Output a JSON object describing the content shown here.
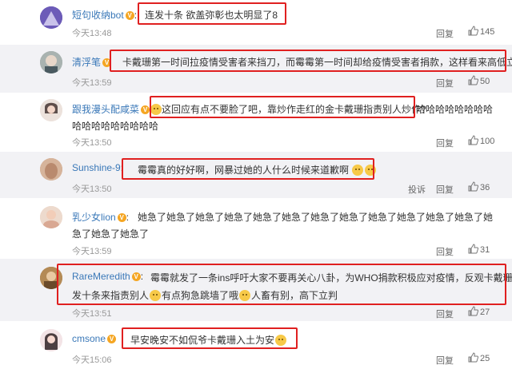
{
  "comments": [
    {
      "user": "短句收纳bot",
      "text": "连发十条 欲盖弥彰也太明显了8",
      "time": "今天13:48",
      "reply": "回复",
      "likes": "145"
    },
    {
      "user": "清浮笔",
      "text": "卡戴珊第一时间拉疫情受害者来挡刀，而霉霉第一时间却给疫情受害者捐款，这样看来高低立现",
      "time": "今天13:59",
      "reply": "回复",
      "likes": "50"
    },
    {
      "user": "跟我漫头配咸菜",
      "text1": "这回应有点不要脸了吧，靠炒作走红的金卡戴珊指责别人炒作?",
      "text1_tail": "哈哈哈哈哈哈哈哈",
      "text2": "哈哈哈哈哈哈哈哈哈",
      "time": "今天13:50",
      "reply": "回复",
      "likes": "100"
    },
    {
      "user": "Sunshine-9",
      "text": "霉霉真的好好啊，网暴过她的人什么时候来道歉啊",
      "time": "今天13:50",
      "report": "投诉",
      "reply": "回复",
      "likes": "36"
    },
    {
      "user": "乳少女lion",
      "text1": "她急了她急了她急了她急了她急了她急了她急了她急了她急了她急了她急了她急了她",
      "text2": "急了她急了她急了",
      "time": "今天13:59",
      "reply": "回复",
      "likes": "31"
    },
    {
      "user": "RareMeredith",
      "text1": "霉霉就发了一条ins呼吁大家不要再关心八卦，为WHO捐款积极应对疫情，反观卡戴珊连",
      "text2a": "发十条来指责别人",
      "text2b": "有点狗急跳墙了哦",
      "text2c": "人畜有别，高下立判",
      "time": "今天13:51",
      "reply": "回复",
      "likes": "27"
    },
    {
      "user": "cmsone",
      "text": "早安晚安不如侃爷卡戴珊入土为安",
      "time": "今天15:06",
      "reply": "回复",
      "likes": "25"
    }
  ]
}
